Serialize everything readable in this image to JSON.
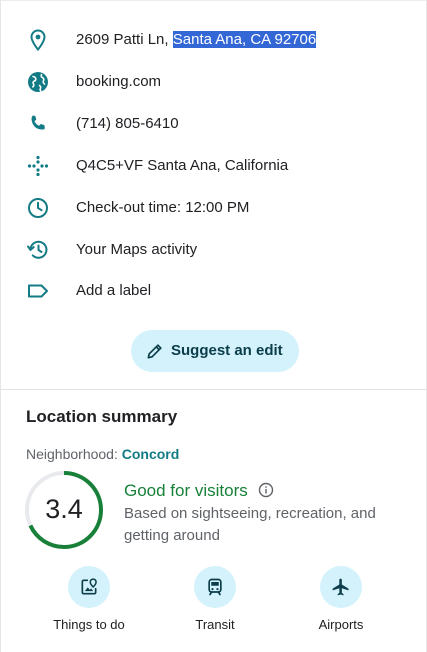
{
  "info_rows": [
    {
      "icon": "location-pin-icon",
      "text_plain": "2609 Patti Ln, ",
      "text_selected": "Santa Ana, CA 92706"
    },
    {
      "icon": "globe-icon",
      "text": "booking.com"
    },
    {
      "icon": "phone-icon",
      "text": "(714) 805-6410"
    },
    {
      "icon": "plus-code-icon",
      "text": "Q4C5+VF Santa Ana, California"
    },
    {
      "icon": "clock-icon",
      "text": "Check-out time: 12:00 PM"
    },
    {
      "icon": "history-icon",
      "text": "Your Maps activity"
    },
    {
      "icon": "label-icon",
      "text": "Add a label"
    }
  ],
  "suggest_edit": {
    "label": "Suggest an edit",
    "icon": "pencil-icon"
  },
  "location_summary": {
    "title": "Location summary",
    "neighborhood_label": "Neighborhood: ",
    "neighborhood_name": "Concord",
    "score": "3.4",
    "score_fraction": 0.68,
    "rating_title": "Good for visitors",
    "rating_description": "Based on sightseeing, recreation, and getting around",
    "categories": [
      {
        "label": "Things to do",
        "icon": "attractions-icon"
      },
      {
        "label": "Transit",
        "icon": "train-icon"
      },
      {
        "label": "Airports",
        "icon": "airplane-icon"
      }
    ]
  },
  "colors": {
    "accent_teal": "#137b85",
    "button_bg": "#d3f2fb",
    "rating_green": "#188038",
    "selection_blue": "#3367d6"
  }
}
